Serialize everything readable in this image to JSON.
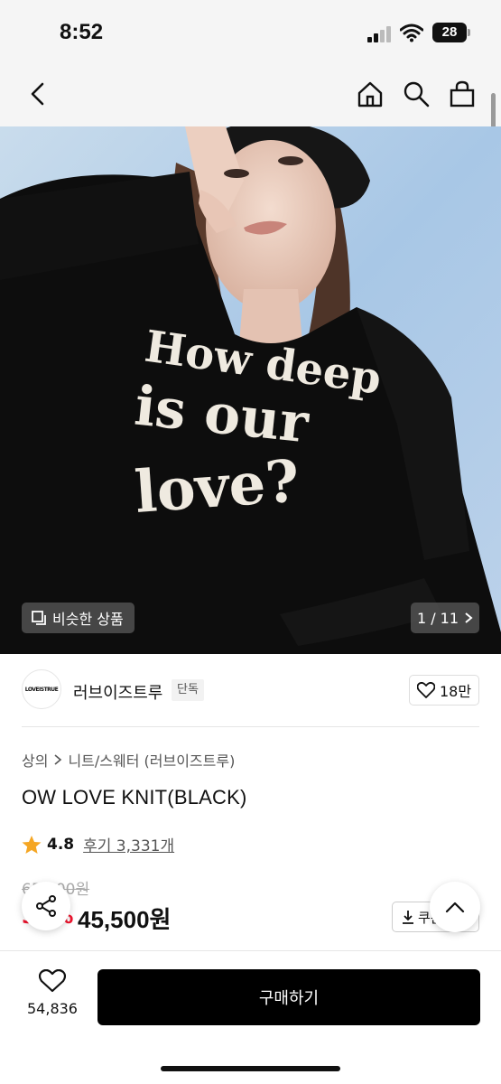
{
  "status_bar": {
    "time": "8:52",
    "battery": "28"
  },
  "nav": {
    "back": "back-icon",
    "home": "home-icon",
    "search": "search-icon",
    "cart": "bag-icon"
  },
  "hero": {
    "similar_label": "비슷한 상품",
    "page_counter": "1 / 11",
    "sweater_text": [
      "How deep",
      "is our",
      "love?"
    ]
  },
  "brand": {
    "name": "러브이즈트루",
    "tag": "단독",
    "logo_text": "LOVEISTRUE",
    "likes": "18만"
  },
  "breadcrumb": {
    "category": "상의",
    "subcategory": "니트/스웨터 (러브이즈트루)"
  },
  "product": {
    "title": "OW LOVE KNIT(BLACK)",
    "rating": "4.8",
    "reviews": "후기 3,331개",
    "original_price": "65,000원",
    "discount": "30%",
    "price": "45,500원",
    "coupon_label": "쿠폰"
  },
  "bottom": {
    "wish_count": "54,836",
    "buy_label": "구매하기"
  },
  "colors": {
    "accent": "#f0142e",
    "star": "#f5a623",
    "buy": "#000000"
  }
}
